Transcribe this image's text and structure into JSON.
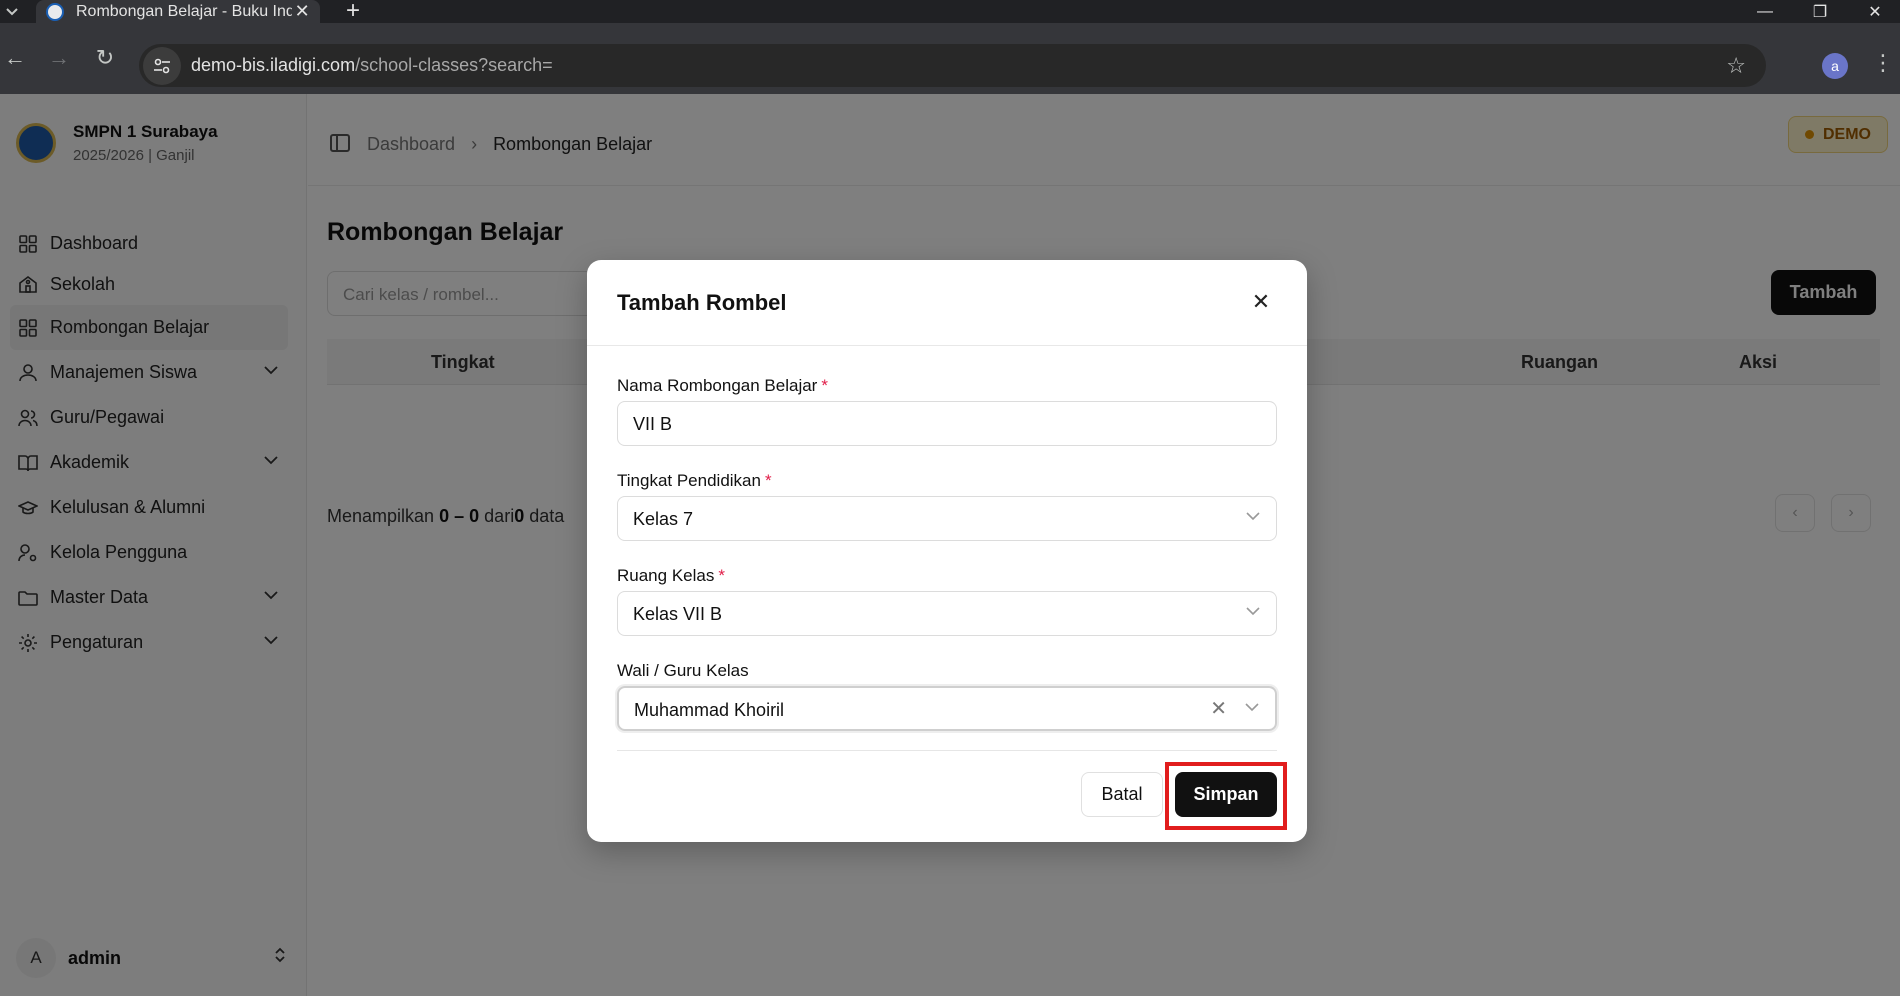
{
  "browser": {
    "tab_title": "Rombongan Belajar - Buku Indu",
    "url_host": "demo-bis.iladigi.com",
    "url_path": "/school-classes?search=",
    "profile_initial": "a"
  },
  "sidebar": {
    "school_name": "SMPN 1 Surabaya",
    "school_year": "2025/2026 | Ganjil",
    "items": [
      {
        "label": "Dashboard",
        "icon": "grid-icon"
      },
      {
        "label": "Sekolah",
        "icon": "school-icon"
      },
      {
        "label": "Rombongan Belajar",
        "icon": "grid-icon"
      },
      {
        "label": "Manajemen Siswa",
        "icon": "user-icon"
      },
      {
        "label": "Guru/Pegawai",
        "icon": "users-icon"
      },
      {
        "label": "Akademik",
        "icon": "book-icon"
      },
      {
        "label": "Kelulusan & Alumni",
        "icon": "graduation-cap-icon"
      },
      {
        "label": "Kelola Pengguna",
        "icon": "user-cog-icon"
      },
      {
        "label": "Master Data",
        "icon": "folder-icon"
      },
      {
        "label": "Pengaturan",
        "icon": "gear-icon"
      }
    ],
    "user_initial": "A",
    "user_name": "admin"
  },
  "header": {
    "breadcrumb_home": "Dashboard",
    "breadcrumb_current": "Rombongan Belajar",
    "demo_badge": "DEMO"
  },
  "page": {
    "title": "Rombongan Belajar",
    "search_placeholder": "Cari kelas / rombel...",
    "add_button": "Tambah",
    "columns": {
      "tingkat": "Tingkat",
      "ruangan": "Ruangan",
      "aksi": "Aksi"
    },
    "showing_prefix": "Menampilkan",
    "showing_from": "0",
    "showing_dash": "–",
    "showing_to": "0",
    "showing_of": "dari",
    "showing_total": "0",
    "showing_suffix": "data"
  },
  "modal": {
    "title": "Tambah Rombel",
    "fields": {
      "nama": {
        "label": "Nama Rombongan Belajar",
        "required": "*",
        "value": "VII B"
      },
      "tingkat": {
        "label": "Tingkat Pendidikan",
        "required": "*",
        "value": "Kelas 7"
      },
      "ruang": {
        "label": "Ruang Kelas",
        "required": "*",
        "value": "Kelas VII B"
      },
      "wali": {
        "label": "Wali / Guru Kelas",
        "value": "Muhammad Khoiril"
      }
    },
    "cancel_button": "Batal",
    "save_button": "Simpan"
  },
  "colors": {
    "highlight": "#e11d1d",
    "accent": "#111111",
    "required": "#e11d48",
    "demo": "#a15c00"
  }
}
